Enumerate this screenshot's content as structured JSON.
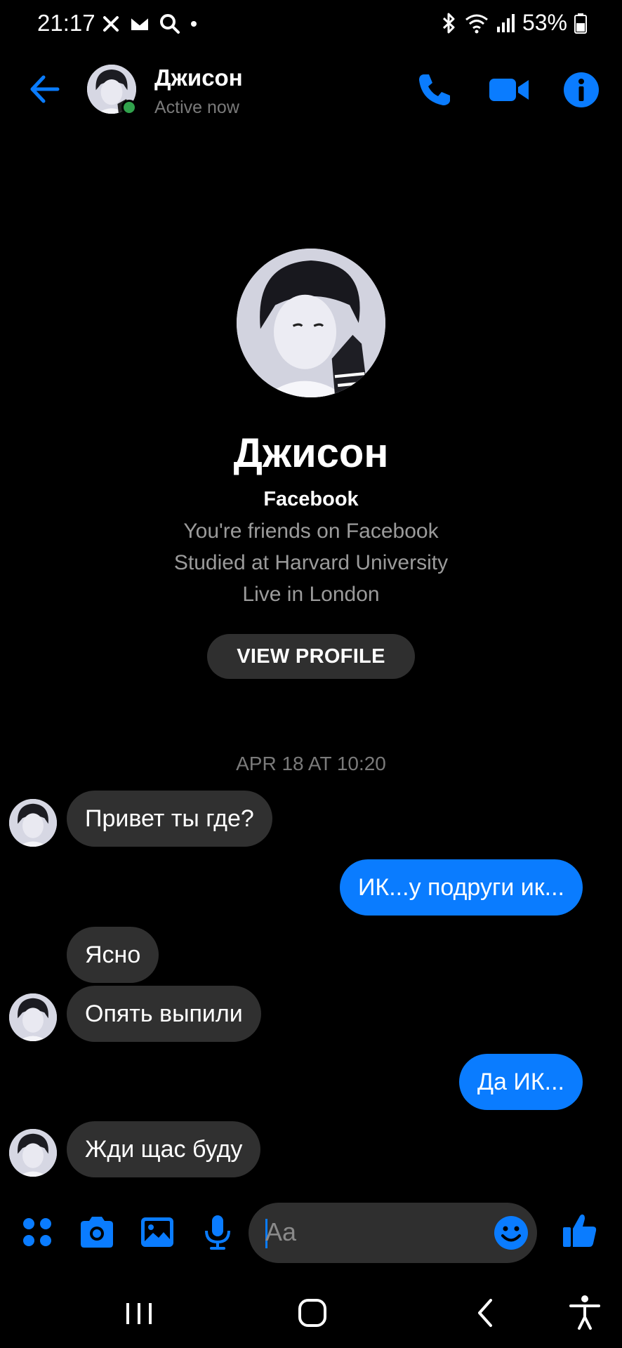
{
  "status_bar": {
    "time": "21:17",
    "battery": "53%"
  },
  "header": {
    "name": "Джисон",
    "status": "Active now"
  },
  "profile": {
    "name": "Джисон",
    "source": "Facebook",
    "info": [
      "You're friends on Facebook",
      "Studied at Harvard University",
      "Live in London"
    ],
    "button_label": "VIEW PROFILE"
  },
  "conversation": {
    "timestamp": "APR 18 AT 10:20",
    "messages": [
      {
        "side": "incoming",
        "text": "Привет ты где?"
      },
      {
        "side": "outgoing",
        "text": "ИК...у подруги ик..."
      },
      {
        "side": "incoming",
        "text": "Ясно"
      },
      {
        "side": "incoming",
        "text": "Опять выпили"
      },
      {
        "side": "outgoing",
        "text": "Да ИК..."
      },
      {
        "side": "incoming",
        "text": "Жди щас буду"
      }
    ]
  },
  "composer": {
    "placeholder": "Aa"
  },
  "colors": {
    "accent": "#0a7cff",
    "incoming_bubble": "#303030",
    "background": "#000000",
    "online": "#31a24c"
  },
  "icons": {
    "header": [
      "back-arrow-icon",
      "phone-icon",
      "video-camera-icon",
      "info-icon"
    ],
    "composer": [
      "apps-grid-icon",
      "camera-icon",
      "gallery-icon",
      "microphone-icon",
      "emoji-icon",
      "thumbs-up-icon"
    ],
    "navigation": [
      "recents-icon",
      "home-icon",
      "back-icon",
      "accessibility-icon"
    ]
  }
}
